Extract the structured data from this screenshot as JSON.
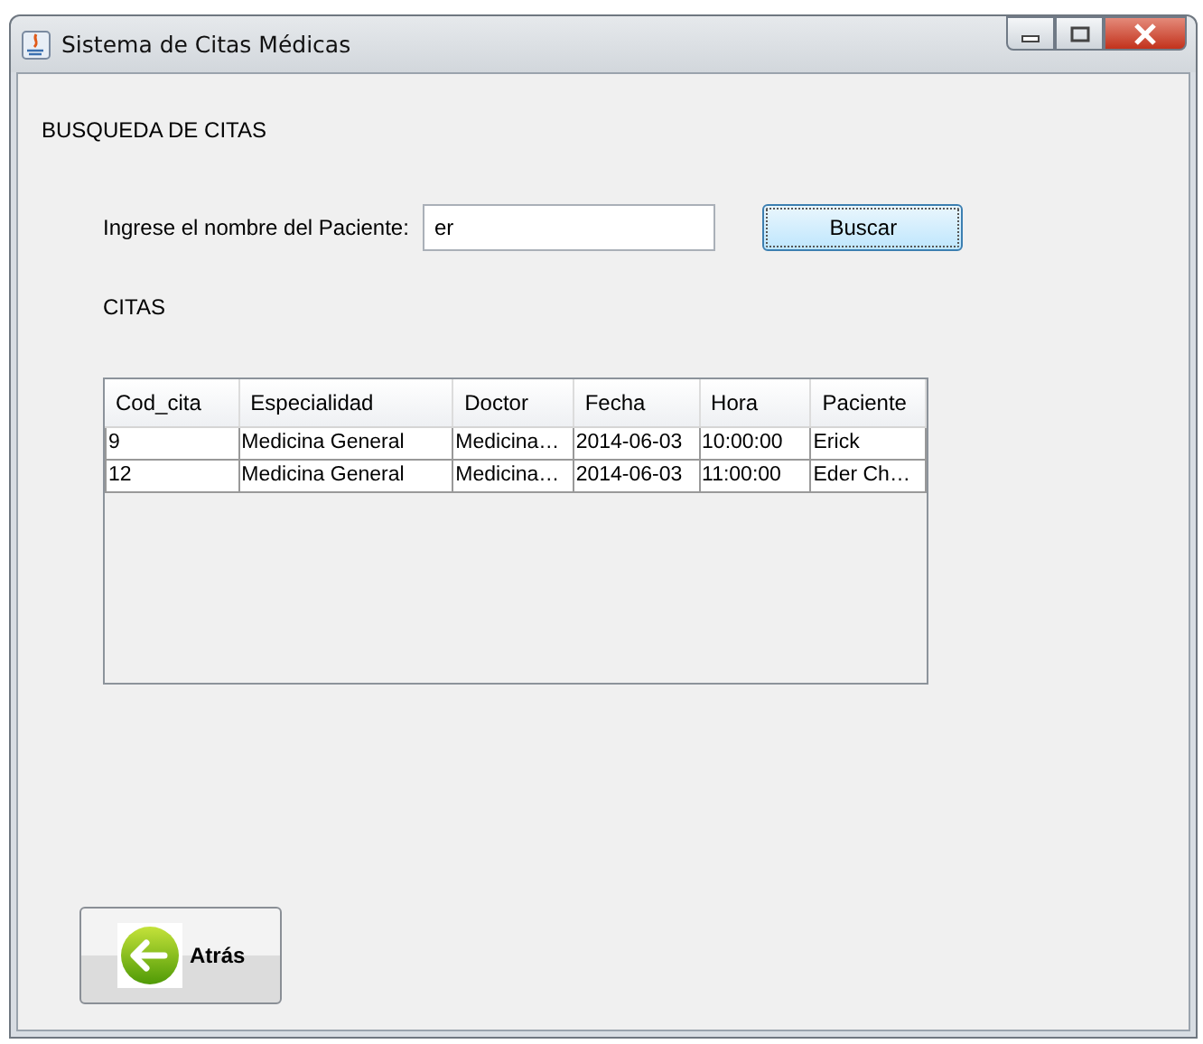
{
  "window": {
    "title": "Sistema de Citas Médicas"
  },
  "heading": "BUSQUEDA DE CITAS",
  "search": {
    "label": "Ingrese el nombre del Paciente:",
    "value": "er",
    "button": "Buscar"
  },
  "section_label": "CITAS",
  "table": {
    "columns": [
      "Cod_cita",
      "Especialidad",
      "Doctor",
      "Fecha",
      "Hora",
      "Paciente"
    ],
    "rows": [
      [
        "9",
        "Medicina General",
        "Medicina…",
        "2014-06-03",
        "10:00:00",
        "Erick"
      ],
      [
        "12",
        "Medicina General",
        "Medicina…",
        "2014-06-03",
        "11:00:00",
        "Eder Ch…"
      ]
    ]
  },
  "back_button": "Atrás"
}
